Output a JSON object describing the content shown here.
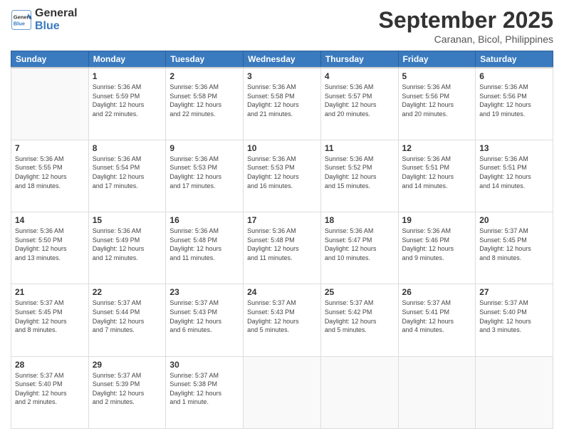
{
  "header": {
    "logo_general": "General",
    "logo_blue": "Blue",
    "month": "September 2025",
    "location": "Caranan, Bicol, Philippines"
  },
  "weekdays": [
    "Sunday",
    "Monday",
    "Tuesday",
    "Wednesday",
    "Thursday",
    "Friday",
    "Saturday"
  ],
  "weeks": [
    [
      {
        "day": "",
        "info": ""
      },
      {
        "day": "1",
        "info": "Sunrise: 5:36 AM\nSunset: 5:59 PM\nDaylight: 12 hours\nand 22 minutes."
      },
      {
        "day": "2",
        "info": "Sunrise: 5:36 AM\nSunset: 5:58 PM\nDaylight: 12 hours\nand 22 minutes."
      },
      {
        "day": "3",
        "info": "Sunrise: 5:36 AM\nSunset: 5:58 PM\nDaylight: 12 hours\nand 21 minutes."
      },
      {
        "day": "4",
        "info": "Sunrise: 5:36 AM\nSunset: 5:57 PM\nDaylight: 12 hours\nand 20 minutes."
      },
      {
        "day": "5",
        "info": "Sunrise: 5:36 AM\nSunset: 5:56 PM\nDaylight: 12 hours\nand 20 minutes."
      },
      {
        "day": "6",
        "info": "Sunrise: 5:36 AM\nSunset: 5:56 PM\nDaylight: 12 hours\nand 19 minutes."
      }
    ],
    [
      {
        "day": "7",
        "info": "Sunrise: 5:36 AM\nSunset: 5:55 PM\nDaylight: 12 hours\nand 18 minutes."
      },
      {
        "day": "8",
        "info": "Sunrise: 5:36 AM\nSunset: 5:54 PM\nDaylight: 12 hours\nand 17 minutes."
      },
      {
        "day": "9",
        "info": "Sunrise: 5:36 AM\nSunset: 5:53 PM\nDaylight: 12 hours\nand 17 minutes."
      },
      {
        "day": "10",
        "info": "Sunrise: 5:36 AM\nSunset: 5:53 PM\nDaylight: 12 hours\nand 16 minutes."
      },
      {
        "day": "11",
        "info": "Sunrise: 5:36 AM\nSunset: 5:52 PM\nDaylight: 12 hours\nand 15 minutes."
      },
      {
        "day": "12",
        "info": "Sunrise: 5:36 AM\nSunset: 5:51 PM\nDaylight: 12 hours\nand 14 minutes."
      },
      {
        "day": "13",
        "info": "Sunrise: 5:36 AM\nSunset: 5:51 PM\nDaylight: 12 hours\nand 14 minutes."
      }
    ],
    [
      {
        "day": "14",
        "info": "Sunrise: 5:36 AM\nSunset: 5:50 PM\nDaylight: 12 hours\nand 13 minutes."
      },
      {
        "day": "15",
        "info": "Sunrise: 5:36 AM\nSunset: 5:49 PM\nDaylight: 12 hours\nand 12 minutes."
      },
      {
        "day": "16",
        "info": "Sunrise: 5:36 AM\nSunset: 5:48 PM\nDaylight: 12 hours\nand 11 minutes."
      },
      {
        "day": "17",
        "info": "Sunrise: 5:36 AM\nSunset: 5:48 PM\nDaylight: 12 hours\nand 11 minutes."
      },
      {
        "day": "18",
        "info": "Sunrise: 5:36 AM\nSunset: 5:47 PM\nDaylight: 12 hours\nand 10 minutes."
      },
      {
        "day": "19",
        "info": "Sunrise: 5:36 AM\nSunset: 5:46 PM\nDaylight: 12 hours\nand 9 minutes."
      },
      {
        "day": "20",
        "info": "Sunrise: 5:37 AM\nSunset: 5:45 PM\nDaylight: 12 hours\nand 8 minutes."
      }
    ],
    [
      {
        "day": "21",
        "info": "Sunrise: 5:37 AM\nSunset: 5:45 PM\nDaylight: 12 hours\nand 8 minutes."
      },
      {
        "day": "22",
        "info": "Sunrise: 5:37 AM\nSunset: 5:44 PM\nDaylight: 12 hours\nand 7 minutes."
      },
      {
        "day": "23",
        "info": "Sunrise: 5:37 AM\nSunset: 5:43 PM\nDaylight: 12 hours\nand 6 minutes."
      },
      {
        "day": "24",
        "info": "Sunrise: 5:37 AM\nSunset: 5:43 PM\nDaylight: 12 hours\nand 5 minutes."
      },
      {
        "day": "25",
        "info": "Sunrise: 5:37 AM\nSunset: 5:42 PM\nDaylight: 12 hours\nand 5 minutes."
      },
      {
        "day": "26",
        "info": "Sunrise: 5:37 AM\nSunset: 5:41 PM\nDaylight: 12 hours\nand 4 minutes."
      },
      {
        "day": "27",
        "info": "Sunrise: 5:37 AM\nSunset: 5:40 PM\nDaylight: 12 hours\nand 3 minutes."
      }
    ],
    [
      {
        "day": "28",
        "info": "Sunrise: 5:37 AM\nSunset: 5:40 PM\nDaylight: 12 hours\nand 2 minutes."
      },
      {
        "day": "29",
        "info": "Sunrise: 5:37 AM\nSunset: 5:39 PM\nDaylight: 12 hours\nand 2 minutes."
      },
      {
        "day": "30",
        "info": "Sunrise: 5:37 AM\nSunset: 5:38 PM\nDaylight: 12 hours\nand 1 minute."
      },
      {
        "day": "",
        "info": ""
      },
      {
        "day": "",
        "info": ""
      },
      {
        "day": "",
        "info": ""
      },
      {
        "day": "",
        "info": ""
      }
    ]
  ]
}
